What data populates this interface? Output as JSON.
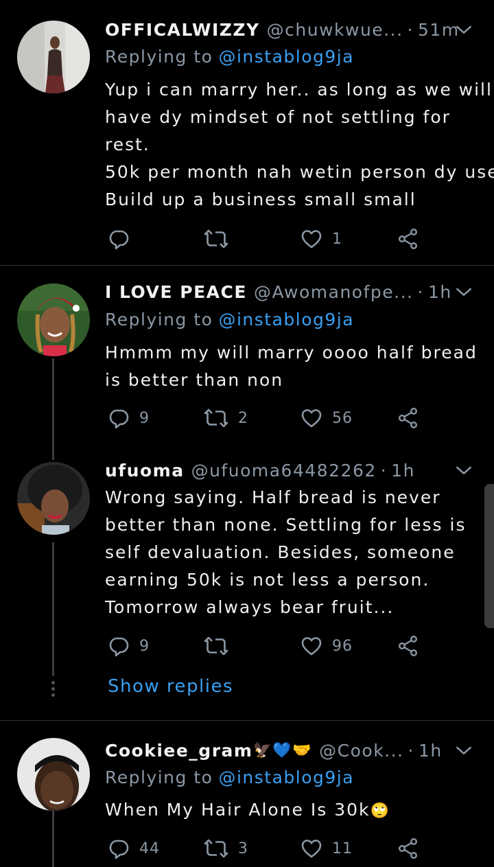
{
  "tweets": [
    {
      "name": "OFFICALWIZZY",
      "handle": "@chuwkwue...",
      "sep": "·",
      "time": "51m",
      "replying_label": "Replying to",
      "replying_to": "@instablog9ja",
      "lines": [
        "Yup i can marry her.. as long as we will",
        "have dy mindset of not settling for",
        "rest.",
        "50k per month nah wetin person dy use",
        "Build up a business small small"
      ],
      "replies": "",
      "retweets": "",
      "likes": "1"
    },
    {
      "name": "I LOVE PEACE",
      "handle": "@Awomanofpe...",
      "sep": "·",
      "time": "1h",
      "replying_label": "Replying to",
      "replying_to": "@instablog9ja",
      "lines": [
        "Hmmm my will marry oooo half bread",
        "is better than non"
      ],
      "replies": "9",
      "retweets": "2",
      "likes": "56"
    },
    {
      "name": "ufuoma",
      "handle": "@ufuoma64482262",
      "sep": "·",
      "time": "1h",
      "lines": [
        "Wrong saying. Half bread is never",
        "better than none. Settling for less is",
        "self devaluation. Besides, someone",
        "earning 50k is not less a person.",
        "Tomorrow always bear fruit..."
      ],
      "replies": "9",
      "retweets": "",
      "likes": "96"
    },
    {
      "name": "Cookiee_gram",
      "name_emojis": "🦅💙🤝",
      "handle": "@Cook...",
      "sep": "·",
      "time": "1h",
      "replying_label": "Replying to",
      "replying_to": "@instablog9ja",
      "lines": [
        "When My Hair Alone Is 30k"
      ],
      "line_emoji": "🙄",
      "replies": "44",
      "retweets": "3",
      "likes": "11"
    }
  ],
  "show_replies": "Show replies",
  "colors": {
    "background": "#000000",
    "accent": "#3aa0f2",
    "muted": "#8b98a5",
    "divider": "#2f3336"
  },
  "icons": [
    "reply-icon",
    "retweet-icon",
    "like-icon",
    "share-icon",
    "chevron-down-icon"
  ]
}
